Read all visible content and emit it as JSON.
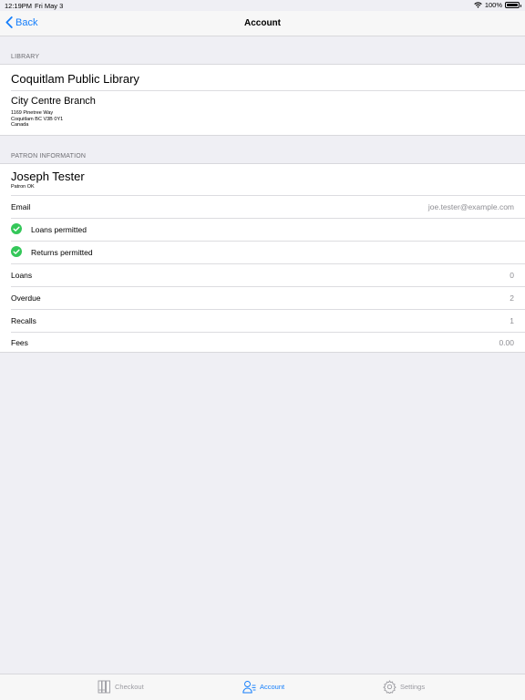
{
  "status_bar": {
    "time": "12:19PM",
    "date": "Fri May 3",
    "battery": "100%"
  },
  "nav": {
    "back_label": "Back",
    "title": "Account"
  },
  "library": {
    "section_header": "LIBRARY",
    "name": "Coquitlam Public Library",
    "branch": "City Centre Branch",
    "address_line1": "1169 Pinetree Way",
    "address_line2": "Coquitlam BC V3B 0Y1",
    "address_line3": "Canada"
  },
  "patron": {
    "section_header": "PATRON INFORMATION",
    "name": "Joseph Tester",
    "status": "Patron OK",
    "email_label": "Email",
    "email_value": "joe.tester@example.com",
    "loans_permitted": "Loans permitted",
    "returns_permitted": "Returns permitted",
    "loans_label": "Loans",
    "loans_value": "0",
    "overdue_label": "Overdue",
    "overdue_value": "2",
    "recalls_label": "Recalls",
    "recalls_value": "1",
    "fees_label": "Fees",
    "fees_value": "0.00"
  },
  "tabs": [
    {
      "label": "Checkout",
      "icon": "books-icon",
      "active": false
    },
    {
      "label": "Account",
      "icon": "person-icon",
      "active": true
    },
    {
      "label": "Settings",
      "icon": "gear-icon",
      "active": false
    }
  ],
  "colors": {
    "accent": "#147efb",
    "check_green": "#34c759",
    "background": "#efeff4"
  }
}
